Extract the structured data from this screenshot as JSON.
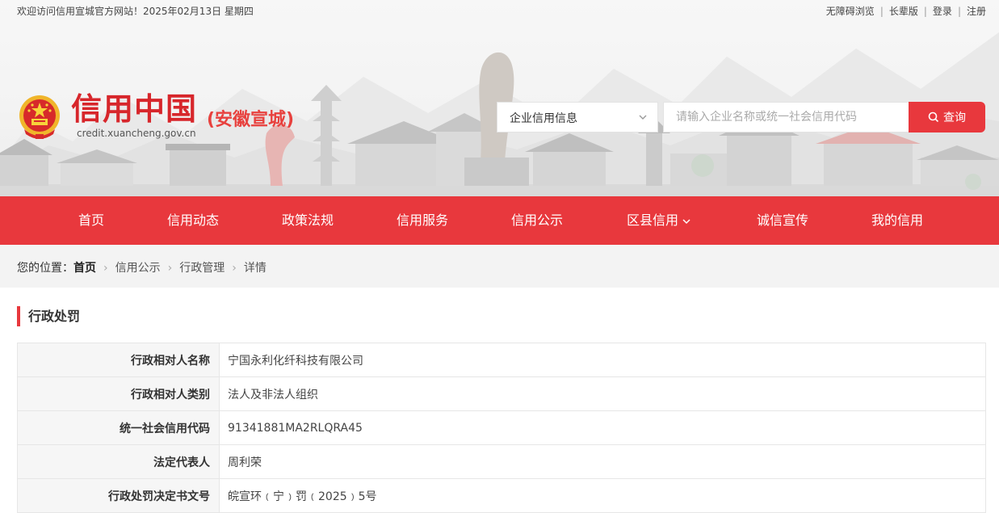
{
  "topbar": {
    "welcome": "欢迎访问信用宣城官方网站！2025年02月13日 星期四",
    "links": [
      "无障碍浏览",
      "长辈版",
      "登录",
      "注册"
    ]
  },
  "logo": {
    "title": "信用中国",
    "subtitle": "(安徽宣城)",
    "domain": "credit.xuancheng.gov.cn",
    "emblem_icon": "national-emblem"
  },
  "search": {
    "category": "企业信用信息",
    "placeholder": "请输入企业名称或统一社会信用代码",
    "button": "查询"
  },
  "nav": {
    "items": [
      "首页",
      "信用动态",
      "政策法规",
      "信用服务",
      "信用公示",
      "区县信用",
      "诚信宣传",
      "我的信用"
    ]
  },
  "breadcrumb": {
    "prefix": "您的位置：",
    "home": "首页",
    "items": [
      "信用公示",
      "行政管理",
      "详情"
    ]
  },
  "section": {
    "title": "行政处罚"
  },
  "details": [
    {
      "label": "行政相对人名称",
      "value": "宁国永利化纤科技有限公司"
    },
    {
      "label": "行政相对人类别",
      "value": "法人及非法人组织"
    },
    {
      "label": "统一社会信用代码",
      "value": "91341881MA2RLQRA45"
    },
    {
      "label": "法定代表人",
      "value": "周利荣"
    },
    {
      "label": "行政处罚决定书文号",
      "value": "皖宣环﹙宁﹚罚﹙2025﹚5号"
    }
  ],
  "colors": {
    "brand_red": "#e8383d",
    "logo_red": "#d7262b",
    "breadcrumb_bg": "#f3f3f3"
  }
}
